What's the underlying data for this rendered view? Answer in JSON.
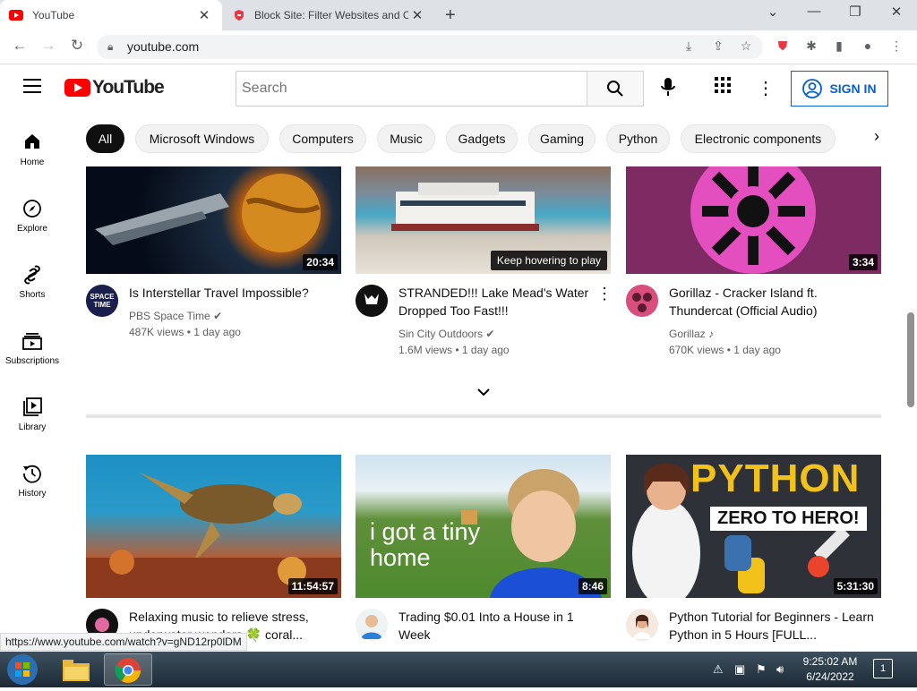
{
  "browser": {
    "tabs": [
      {
        "title": "YouTube",
        "active": true
      },
      {
        "title": "Block Site: Filter Websites and Co",
        "active": false
      }
    ],
    "url": "youtube.com",
    "status_url": "https://www.youtube.com/watch?v=gND12rp0lDM"
  },
  "youtube": {
    "logo_text": "YouTube",
    "search_placeholder": "Search",
    "sign_in": "SIGN IN",
    "chips": [
      "All",
      "Microsoft Windows",
      "Computers",
      "Music",
      "Gadgets",
      "Gaming",
      "Python",
      "Electronic components"
    ],
    "sidebar": [
      {
        "label": "Home",
        "icon": "home-icon"
      },
      {
        "label": "Explore",
        "icon": "compass-icon"
      },
      {
        "label": "Shorts",
        "icon": "shorts-icon"
      },
      {
        "label": "Subscriptions",
        "icon": "subscriptions-icon"
      },
      {
        "label": "Library",
        "icon": "library-icon"
      },
      {
        "label": "History",
        "icon": "history-icon"
      }
    ],
    "row1": [
      {
        "title": "Is Interstellar Travel Impossible?",
        "channel": "PBS Space Time",
        "meta": "487K views • 1 day ago",
        "duration": "20:34",
        "verified": true
      },
      {
        "title": "STRANDED!!! Lake Mead's Water Dropped Too Fast!!!",
        "channel": "Sin City Outdoors",
        "meta": "1.6M views • 1 day ago",
        "hover_text": "Keep hovering to play",
        "verified": true
      },
      {
        "title": "Gorillaz - Cracker Island ft. Thundercat (Official Audio)",
        "channel": "Gorillaz",
        "meta": "670K views • 1 day ago",
        "duration": "3:34",
        "music": true
      }
    ],
    "row2": [
      {
        "title": "Relaxing music to relieve stress, underwater wonders 🍀 coral...",
        "duration": "11:54:57"
      },
      {
        "title": "Trading $0.01 Into a House in 1 Week",
        "duration": "8:46",
        "thumb_text": "i got a tiny home"
      },
      {
        "title": "Python Tutorial for Beginners - Learn Python in 5 Hours [FULL...",
        "duration": "5:31:30",
        "thumb_text1": "PYTHON",
        "thumb_text2": "ZERO TO ",
        "thumb_text3": "HERO!"
      }
    ]
  },
  "taskbar": {
    "time": "9:25:02 AM",
    "date": "6/24/2022",
    "notifications": "1"
  },
  "colors": {
    "youtube_red": "#ff0000",
    "signin_blue": "#065fd4"
  }
}
